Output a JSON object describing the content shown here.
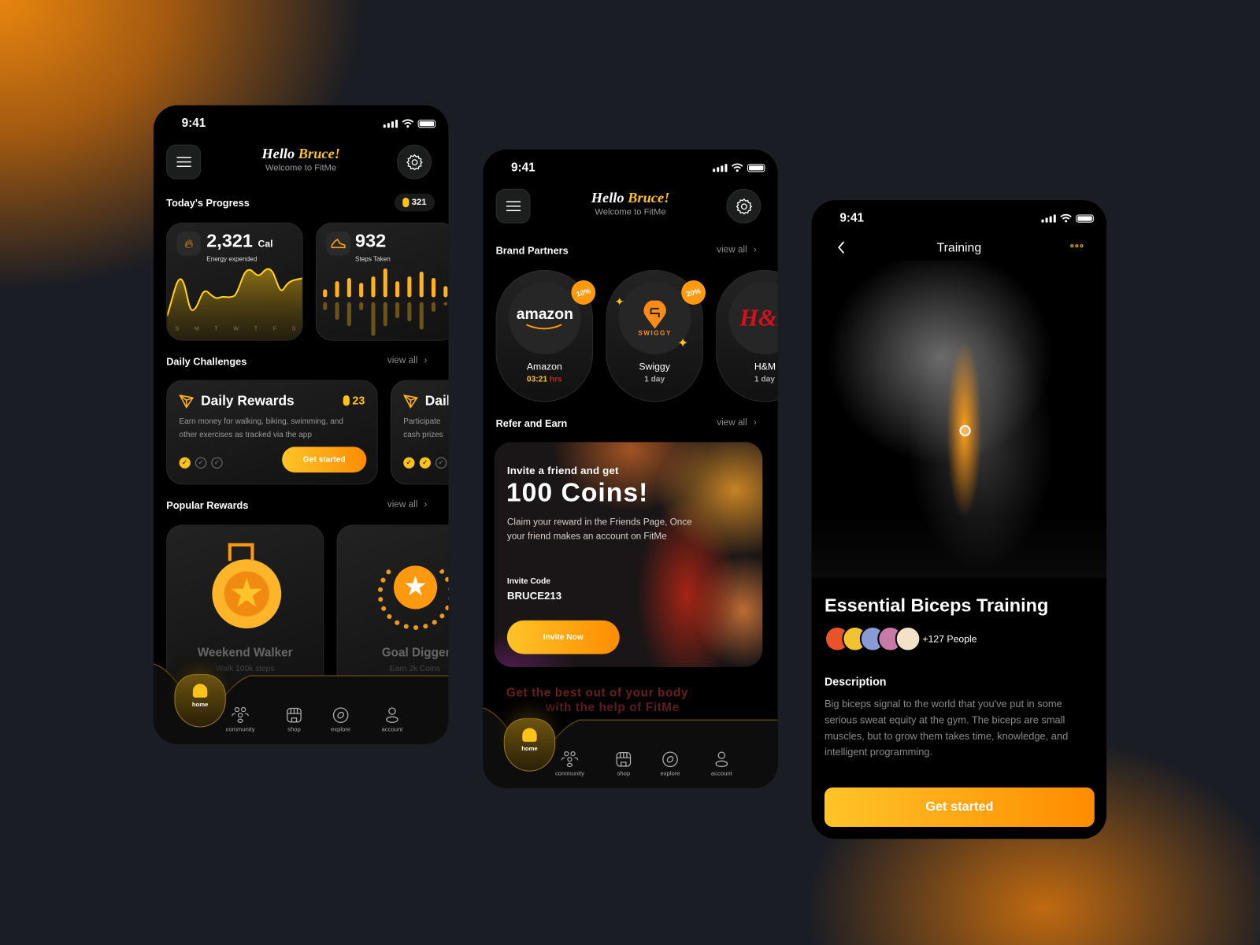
{
  "colors": {
    "accent": "#ffc21a",
    "accent_end": "#ff8c00",
    "bg": "#000000"
  },
  "status": {
    "time": "9:41"
  },
  "header": {
    "hello": "Hello",
    "name": "Bruce!",
    "subtitle": "Welcome to FitMe"
  },
  "home": {
    "progress_title": "Today's Progress",
    "coins": "321",
    "calories": {
      "value": "2,321",
      "unit": "Cal",
      "label": "Energy expended",
      "days": [
        "S",
        "M",
        "T",
        "W",
        "T",
        "F",
        "S"
      ],
      "icon": "flame-icon"
    },
    "steps": {
      "value": "932",
      "label": "Steps Taken",
      "icon": "sneaker-icon"
    },
    "challenges_title": "Daily Challenges",
    "view_all": "view all",
    "challenges": [
      {
        "title": "Daily Rewards",
        "coins": "23",
        "desc": "Earn money for walking, biking, swimming, and other exercises as tracked via the app",
        "checks": [
          true,
          false,
          false
        ],
        "cta": "Get started"
      },
      {
        "title": "Daily",
        "desc": "Participate cash prizes",
        "checks": [
          true,
          true,
          false
        ]
      }
    ],
    "rewards_title": "Popular Rewards",
    "rewards": [
      {
        "title": "Weekend Walker",
        "sub": "Walk 100k steps"
      },
      {
        "title": "Goal Digger",
        "sub": "Earn 2k Coins"
      }
    ]
  },
  "nav": {
    "items": [
      "home",
      "community",
      "shop",
      "explore",
      "account"
    ]
  },
  "partners": {
    "brand_title": "Brand Partners",
    "view_all": "view all",
    "brands": [
      {
        "name": "Amazon",
        "logo": "amazon",
        "time": "03:21",
        "time_unit": "hrs",
        "discount": "10%"
      },
      {
        "name": "Swiggy",
        "logo": "SWIGGY",
        "time": "1 day",
        "discount": "20%"
      },
      {
        "name": "H&M",
        "logo": "H&M",
        "time": "1 day"
      }
    ],
    "refer_title": "Refer and Earn",
    "refer": {
      "line1": "Invite a friend and get",
      "line2": "100 Coins!",
      "desc": "Claim your reward in the Friends Page, Once your friend makes an account on FitMe",
      "code_label": "Invite Code",
      "code": "BRUCE213",
      "cta": "Invite Now"
    },
    "tagline1": "Get the best out of your body",
    "tagline2": "with the help of FitMe"
  },
  "training": {
    "title": "Training",
    "heading": "Essential Biceps Training",
    "people": "+127 People",
    "desc_title": "Description",
    "desc": "Big biceps signal to the world that you've put in some serious sweat equity at the gym. The biceps are small muscles, but to grow them takes time, knowledge, and intelligent programming.",
    "cta": "Get started",
    "avatar_colors": [
      "#e8532a",
      "#f2c230",
      "#8a9ad6",
      "#c77aa8",
      "#f3e2c8"
    ]
  }
}
